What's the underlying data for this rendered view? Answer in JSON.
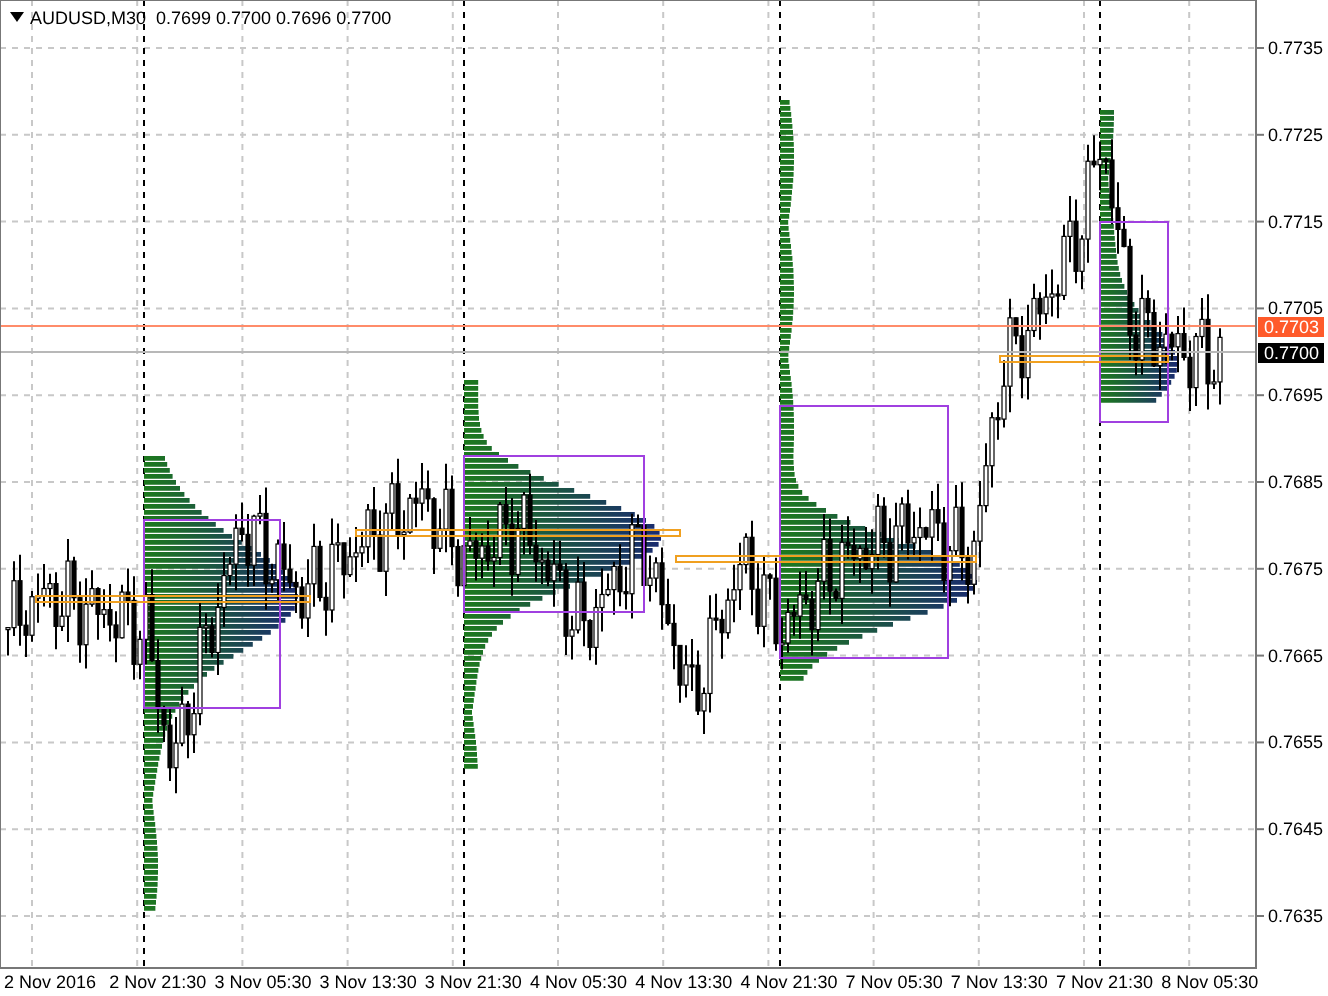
{
  "title": {
    "symbol": "AUDUSD,M30",
    "ohlc": "0.7699 0.7700 0.7696 0.7700"
  },
  "price_axis": [
    "0.7735",
    "0.7725",
    "0.7715",
    "0.7705",
    "0.7695",
    "0.7685",
    "0.7675",
    "0.7665",
    "0.7655",
    "0.7645",
    "0.7635"
  ],
  "time_axis": [
    "2 Nov 2016",
    "2 Nov 21:30",
    "3 Nov 05:30",
    "3 Nov 13:30",
    "3 Nov 21:30",
    "4 Nov 05:30",
    "4 Nov 13:30",
    "4 Nov 21:30",
    "7 Nov 05:30",
    "7 Nov 13:30",
    "7 Nov 21:30",
    "8 Nov 05:30"
  ],
  "price_markers": [
    {
      "label": "0.7703",
      "kind": "bid"
    },
    {
      "label": "0.7700",
      "kind": "current"
    }
  ]
}
